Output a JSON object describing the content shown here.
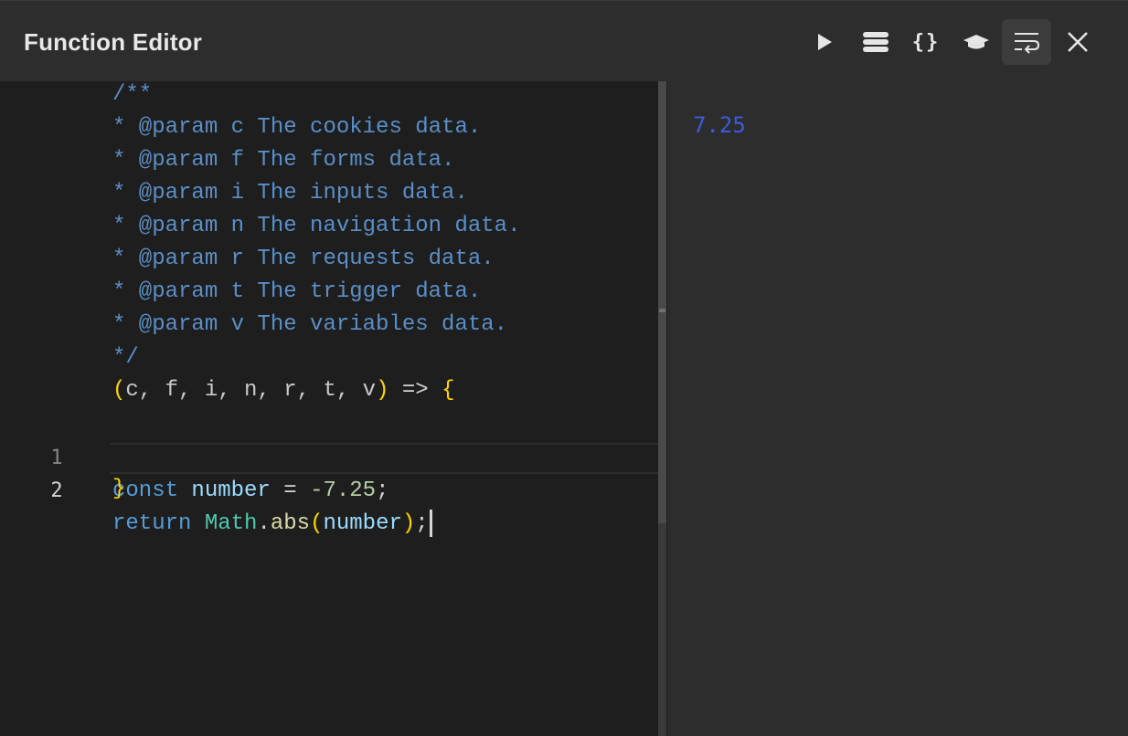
{
  "window": {
    "title": "Function Editor"
  },
  "toolbar": {
    "buttons": [
      {
        "name": "run",
        "icon": "play-icon"
      },
      {
        "name": "data",
        "icon": "database-icon"
      },
      {
        "name": "format",
        "icon": "braces-icon",
        "glyph": "{}"
      },
      {
        "name": "learn",
        "icon": "graduation-cap-icon"
      },
      {
        "name": "wrap",
        "icon": "word-wrap-icon",
        "active": true
      },
      {
        "name": "close",
        "icon": "close-icon"
      }
    ]
  },
  "code": {
    "header_comment": [
      "/**",
      "* @param c The cookies data.",
      "* @param f The forms data.",
      "* @param i The inputs data.",
      "* @param n The navigation data.",
      "* @param r The requests data.",
      "* @param t The trigger data.",
      "* @param v The variables data.",
      "*/"
    ],
    "signature": {
      "open_paren": "(",
      "params": "c, f, i, n, r, t, v",
      "close_paren": ")",
      "arrow": " => ",
      "open_brace": "{"
    },
    "lines": [
      {
        "number": "1",
        "kw": "const",
        "var": "number",
        "op": " = ",
        "num": "-7.25",
        "end": ";"
      },
      {
        "number": "2",
        "kw": "return",
        "obj": "Math",
        "dot": ".",
        "fn": "abs",
        "open": "(",
        "arg": "number",
        "close": ")",
        "end": ";"
      }
    ],
    "closing_brace": "}"
  },
  "output": {
    "value": "7.25"
  },
  "colors": {
    "comment": "#5a8fc8",
    "keyword": "#569cd6",
    "number": "#b5cea8",
    "type": "#4ec9b0",
    "bracket": "#ffd700",
    "output": "#3b5bdb"
  }
}
